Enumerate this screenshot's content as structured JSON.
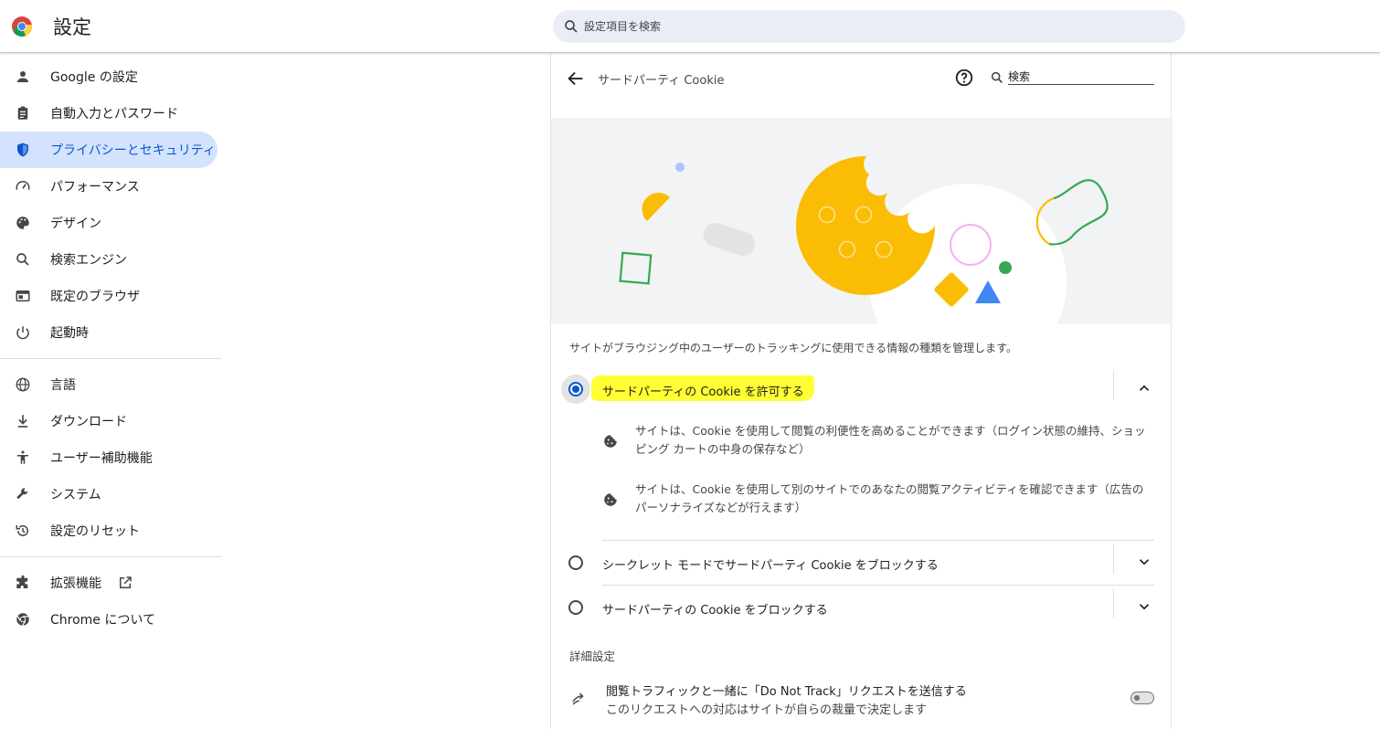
{
  "header": {
    "title": "設定",
    "search_placeholder": "設定項目を検索"
  },
  "sidebar": {
    "items": [
      {
        "label": "Google の設定",
        "icon": "person-icon"
      },
      {
        "label": "自動入力とパスワード",
        "icon": "clipboard-icon"
      },
      {
        "label": "プライバシーとセキュリティ",
        "icon": "shield-icon",
        "active": true
      },
      {
        "label": "パフォーマンス",
        "icon": "speedometer-icon"
      },
      {
        "label": "デザイン",
        "icon": "palette-icon"
      },
      {
        "label": "検索エンジン",
        "icon": "search-icon"
      },
      {
        "label": "既定のブラウザ",
        "icon": "browser-icon"
      },
      {
        "label": "起動時",
        "icon": "power-icon"
      }
    ],
    "items2": [
      {
        "label": "言語",
        "icon": "globe-icon"
      },
      {
        "label": "ダウンロード",
        "icon": "download-icon"
      },
      {
        "label": "ユーザー補助機能",
        "icon": "accessibility-icon"
      },
      {
        "label": "システム",
        "icon": "wrench-icon"
      },
      {
        "label": "設定のリセット",
        "icon": "reset-icon"
      }
    ],
    "items3": [
      {
        "label": "拡張機能",
        "icon": "puzzle-icon"
      },
      {
        "label": "Chrome について",
        "icon": "chrome-icon"
      }
    ]
  },
  "page": {
    "title": "サードパーティ Cookie",
    "search_placeholder": "検索",
    "description": "サイトがブラウジング中のユーザーのトラッキングに使用できる情報の種類を管理します。",
    "options": [
      {
        "label": "サードパーティの Cookie を許可する",
        "checked": true,
        "expanded": true
      },
      {
        "label": "シークレット モードでサードパーティ Cookie をブロックする",
        "checked": false,
        "expanded": false
      },
      {
        "label": "サードパーティの Cookie をブロックする",
        "checked": false,
        "expanded": false
      }
    ],
    "option1_details": [
      "サイトは、Cookie を使用して閲覧の利便性を高めることができます（ログイン状態の維持、ショッピング カートの中身の保存など）",
      "サイトは、Cookie を使用して別のサイトでのあなたの閲覧アクティビティを確認できます（広告のパーソナライズなどが行えます）"
    ],
    "advanced_heading": "詳細設定",
    "dnt_title": "閲覧トラフィックと一緒に「Do Not Track」リクエストを送信する",
    "dnt_subtitle": "このリクエストへの対応はサイトが自らの裁量で決定します",
    "dnt_enabled": false
  },
  "colors": {
    "accent": "#0b57d0",
    "active_bg": "#d3e3fd",
    "highlight": "#ffff33"
  }
}
